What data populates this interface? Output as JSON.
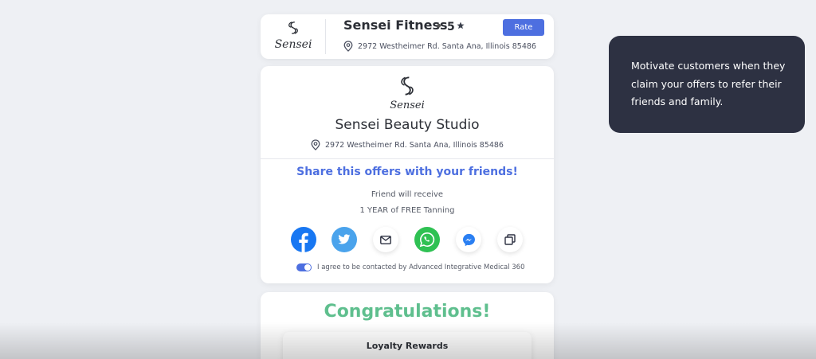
{
  "header": {
    "logo_text": "Sensei",
    "business_name": "Sensei Fitness",
    "separator": "•",
    "rating": "5",
    "rate_button_label": "Rate",
    "address": "2972 Westheimer Rd. Santa Ana, Illinois 85486"
  },
  "main": {
    "logo_text": "Sensei",
    "studio_name": "Sensei Beauty Studio",
    "address": "2972 Westheimer Rd. Santa Ana, Illinois 85486",
    "share_title": "Share this offers with your friends!",
    "friend_receive": "Friend will receive",
    "offer": "1 YEAR of FREE Tanning",
    "share_icons": [
      "facebook-icon",
      "twitter-icon",
      "email-icon",
      "whatsapp-icon",
      "messenger-icon",
      "copy-icon"
    ],
    "agree_text": "I agree to be contacted by Advanced Integrative Medical 360",
    "agree_checked": true
  },
  "tooltip": {
    "text": "Motivate customers when they claim your offers to refer their friends and family."
  },
  "congrats": {
    "title": "Congratulations!",
    "loyalty_label": "Loyalty Rewards"
  },
  "colors": {
    "accent": "#4d6fe0",
    "congrats_green": "#5fbf8e",
    "tooltip_bg": "#2d3142",
    "facebook": "#1877f2",
    "twitter": "#4aa3ec",
    "whatsapp": "#2fc153",
    "messenger": "#2a7ff2"
  }
}
